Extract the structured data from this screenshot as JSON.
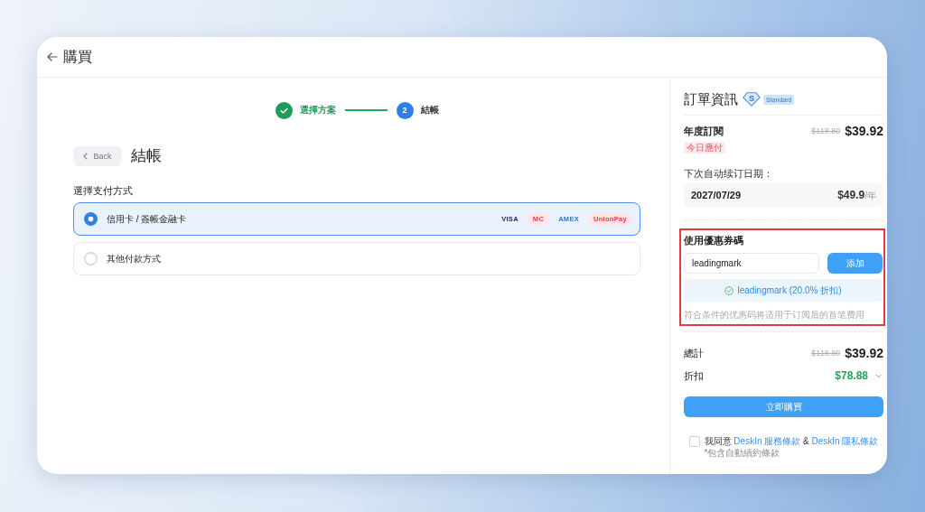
{
  "header": {
    "title": "購買"
  },
  "steps": [
    {
      "label": "選擇方案",
      "completed": true
    },
    {
      "number": "2",
      "label": "結帳",
      "completed": false
    }
  ],
  "checkout": {
    "back_button": "Back",
    "title": "結帳",
    "payment_label": "選擇支付方式",
    "payment_methods": [
      {
        "label": "信用卡 / 簽帳金融卡",
        "selected": true,
        "brands": [
          {
            "label": "VISA",
            "color": "#1f2f6b",
            "tinted": false
          },
          {
            "label": "MC",
            "color": "#e8364a",
            "tinted": true
          },
          {
            "label": "AMEX",
            "color": "#2f7cc8",
            "tinted": false
          },
          {
            "label": "UnionPay",
            "color": "#e8364a",
            "tinted": true
          }
        ]
      },
      {
        "label": "其他付款方式",
        "selected": false
      }
    ]
  },
  "order": {
    "title": "訂單資訊",
    "plan_badge": {
      "letter": "S",
      "label": "Standard"
    },
    "plan": {
      "name": "年度訂閱",
      "original_price": "$118.80",
      "price": "$39.92",
      "due_tag": "今日應付"
    },
    "renewal": {
      "label": "下次自动续订日期：",
      "date": "2027/07/29",
      "price": "$49.9",
      "unit": "/年"
    },
    "coupon": {
      "highlighted": true,
      "title": "使用優惠券碼",
      "value": "leadingmark",
      "button": "添加",
      "applied": "leadingmark (20.0% 折扣)",
      "note": "符合条件的优惠码将适用于订阅后的首笔费用"
    },
    "totals": [
      {
        "kind": "total",
        "label": "總計",
        "original": "$118.80",
        "amount": "$39.92"
      },
      {
        "kind": "discount",
        "label": "折扣",
        "amount": "$78.88",
        "expanded": false
      }
    ],
    "buy_button": "立即購買",
    "agreement": {
      "checked": false,
      "parts": [
        {
          "kind": "text",
          "text": "我同意"
        },
        {
          "kind": "link",
          "text": "DeskIn 服務條款"
        },
        {
          "kind": "text",
          "text": "&"
        },
        {
          "kind": "link",
          "text": "DeskIn 隱私條款"
        }
      ],
      "note": "*包含自動續約條款"
    }
  }
}
